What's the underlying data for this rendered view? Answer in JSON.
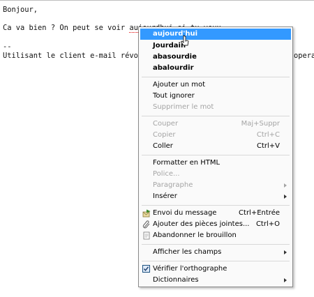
{
  "editor": {
    "greeting": "Bonjour,",
    "line2_before": "Ca va bien ? On peut se voir ",
    "line2_word": "aujourdhui",
    "line2_after": " si tu veux",
    "signature_sep": "--",
    "signature": "Utilisant le client e-mail révo",
    "signature_tail": "opera"
  },
  "menu": {
    "suggestions": [
      "aujourd'hui",
      "Jourdain",
      "abasourdie",
      "abalourdir"
    ],
    "add_word": "Ajouter un mot",
    "ignore_all": "Tout ignorer",
    "delete_word": "Supprimer le mot",
    "cut": "Couper",
    "cut_shortcut": "Maj+Suppr",
    "copy": "Copier",
    "copy_shortcut": "Ctrl+C",
    "paste": "Coller",
    "paste_shortcut": "Ctrl+V",
    "format_html": "Formatter en HTML",
    "font": "Police...",
    "paragraph": "Paragraphe",
    "insert": "Insérer",
    "send": "Envoi du message",
    "send_shortcut": "Ctrl+Entrée",
    "attach": "Ajouter des pièces jointes...",
    "attach_shortcut": "Ctrl+O",
    "discard": "Abandonner le brouillon",
    "show_fields": "Afficher les champs",
    "spellcheck": "Vérifier l'orthographe",
    "dictionaries": "Dictionnaires"
  },
  "colors": {
    "highlight": "#3399ff",
    "disabled_text": "#a4a4a4",
    "misspelling_underline": "#e00000"
  }
}
